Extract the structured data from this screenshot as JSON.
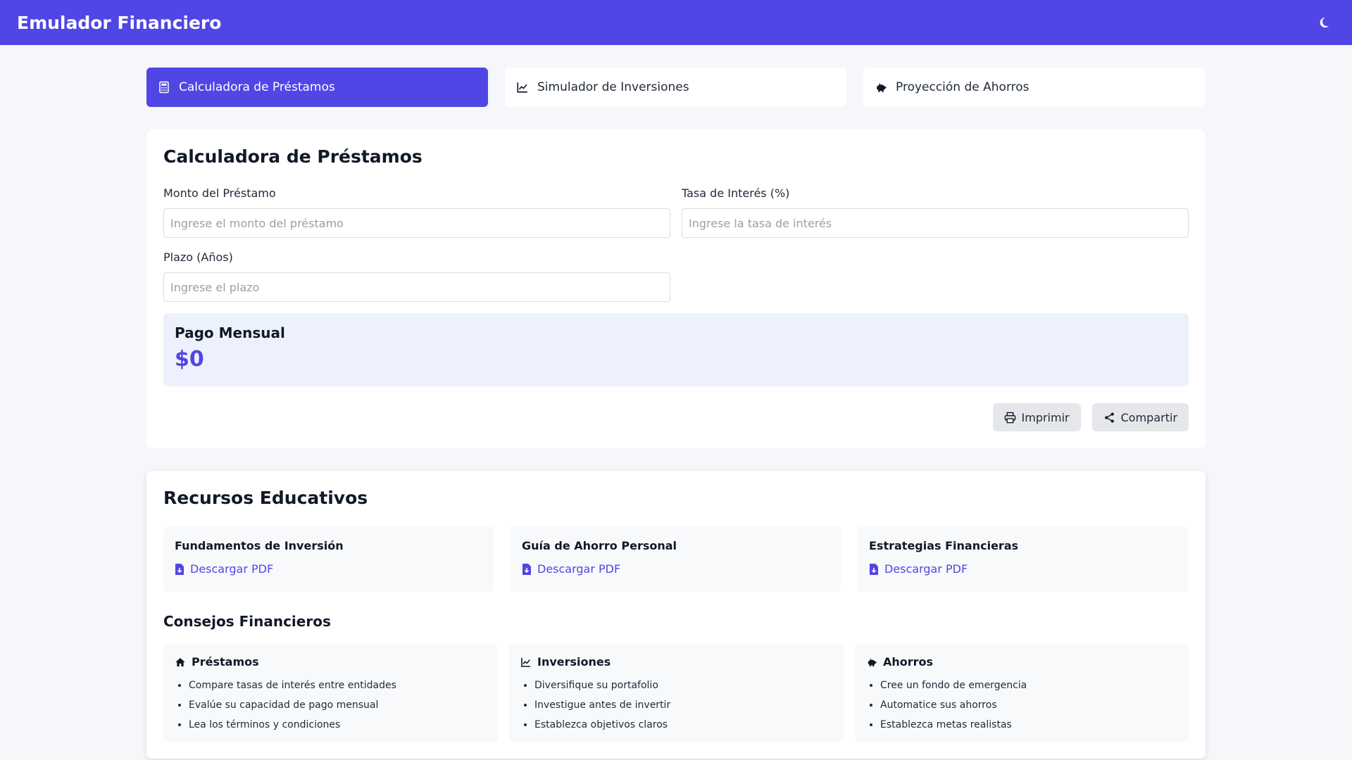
{
  "header": {
    "title": "Emulador Financiero",
    "theme_icon": "moon-icon"
  },
  "tabs": [
    {
      "label": "Calculadora de Préstamos",
      "icon": "calculator-icon",
      "active": true
    },
    {
      "label": "Simulador de Inversiones",
      "icon": "chart-line-icon",
      "active": false
    },
    {
      "label": "Proyección de Ahorros",
      "icon": "piggy-bank-icon",
      "active": false
    }
  ],
  "calculator": {
    "title": "Calculadora de Préstamos",
    "fields": {
      "amount": {
        "label": "Monto del Préstamo",
        "placeholder": "Ingrese el monto del préstamo",
        "value": ""
      },
      "rate": {
        "label": "Tasa de Interés (%)",
        "placeholder": "Ingrese la tasa de interés",
        "value": ""
      },
      "term": {
        "label": "Plazo (Años)",
        "placeholder": "Ingrese el plazo",
        "value": ""
      }
    },
    "result": {
      "label": "Pago Mensual",
      "value": "$0"
    },
    "actions": {
      "print_label": "Imprimir",
      "share_label": "Compartir"
    }
  },
  "education": {
    "title": "Recursos Educativos",
    "resources": [
      {
        "title": "Fundamentos de Inversión",
        "link": "Descargar PDF"
      },
      {
        "title": "Guía de Ahorro Personal",
        "link": "Descargar PDF"
      },
      {
        "title": "Estrategias Financieras",
        "link": "Descargar PDF"
      }
    ],
    "tips_title": "Consejos Financieros",
    "tips": [
      {
        "title": "Préstamos",
        "icon": "home-icon",
        "items": [
          "Compare tasas de interés entre entidades",
          "Evalúe su capacidad de pago mensual",
          "Lea los términos y condiciones"
        ]
      },
      {
        "title": "Inversiones",
        "icon": "chart-line-icon",
        "items": [
          "Diversifique su portafolio",
          "Investigue antes de invertir",
          "Establezca objetivos claros"
        ]
      },
      {
        "title": "Ahorros",
        "icon": "piggy-bank-icon",
        "items": [
          "Cree un fondo de emergencia",
          "Automatice sus ahorros",
          "Establezca metas realistas"
        ]
      }
    ]
  },
  "colors": {
    "primary": "#5046e5",
    "result_bg": "#edf1fd",
    "button_bg": "#e5e7eb",
    "page_bg": "#f5f7fb"
  }
}
